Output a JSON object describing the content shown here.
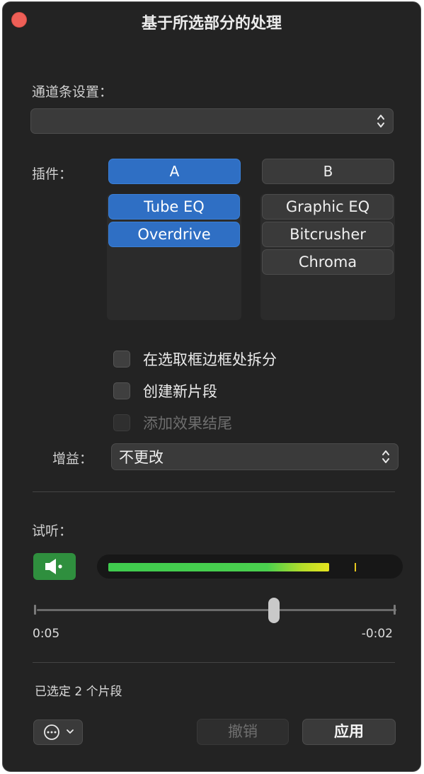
{
  "window": {
    "title": "基于所选部分的处理"
  },
  "channel_strip": {
    "label": "通道条设置：",
    "value": ""
  },
  "plugins": {
    "label": "插件：",
    "tab_a": "A",
    "tab_b": "B",
    "list_a": [
      "Tube EQ",
      "Overdrive"
    ],
    "list_b": [
      "Graphic EQ",
      "Bitcrusher",
      "Chroma"
    ]
  },
  "options": {
    "split_at_edges": {
      "label": "在选取框边框处拆分",
      "checked": false
    },
    "create_new_region": {
      "label": "创建新片段",
      "checked": false
    },
    "add_effect_tail": {
      "label": "添加效果结尾",
      "checked": false,
      "disabled": true
    }
  },
  "gain": {
    "label": "增益：",
    "value": "不更改"
  },
  "preview": {
    "label": "试听：",
    "meter_level": 0.78,
    "meter_peak": 0.87,
    "playhead_fraction": 0.66,
    "time_elapsed": "0:05",
    "time_remaining": "-0:02"
  },
  "status": {
    "text": "已选定 2 个片段"
  },
  "footer": {
    "undo_label": "撤销",
    "apply_label": "应用"
  },
  "colors": {
    "accent": "#2f6fc4",
    "preview_green": "#2f8f3e",
    "close": "#ee5f57",
    "window_bg": "#232323"
  }
}
